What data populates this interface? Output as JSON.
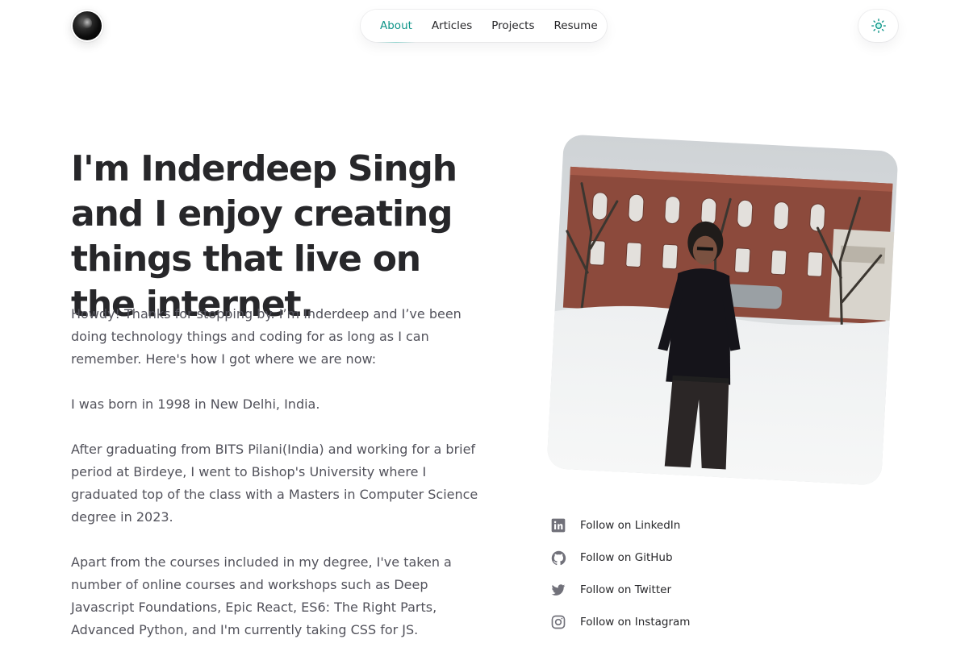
{
  "header": {
    "avatar_alt": "profile-avatar",
    "nav": [
      {
        "label": "About",
        "active": true
      },
      {
        "label": "Articles",
        "active": false
      },
      {
        "label": "Projects",
        "active": false
      },
      {
        "label": "Resume",
        "active": false
      }
    ],
    "theme_icon": "sun-icon"
  },
  "hero": {
    "headline": "I'm Inderdeep Singh and I enjoy creating things that live on the internet.",
    "paragraphs": [
      "Howdy! Thanks for stopping by. I’m Inderdeep and I’ve been doing technology things and coding for as long as I can remember. Here's how I got where we are now:",
      "I was born in 1998 in New Delhi, India.",
      "After graduating from BITS Pilani(India) and working for a brief period at Birdeye, I went to Bishop's University where I graduated top of the class with a Masters in Computer Science degree in 2023.",
      "Apart from the courses included in my degree, I've taken a number of online courses and workshops such as Deep Javascript Foundations, Epic React, ES6: The Right Parts, Advanced Python, and I'm currently taking CSS for JS."
    ]
  },
  "socials": [
    {
      "label": "Follow on LinkedIn",
      "icon": "linkedin-icon"
    },
    {
      "label": "Follow on GitHub",
      "icon": "github-icon"
    },
    {
      "label": "Follow on Twitter",
      "icon": "twitter-icon"
    },
    {
      "label": "Follow on Instagram",
      "icon": "instagram-icon"
    }
  ],
  "colors": {
    "accent": "#0d9488",
    "heading": "#27272a",
    "body": "#52525b",
    "icon": "#71717a"
  }
}
